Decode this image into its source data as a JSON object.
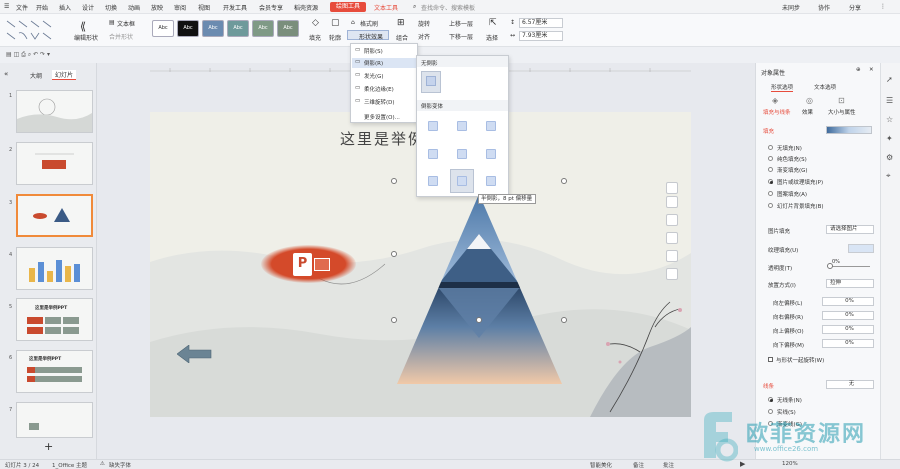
{
  "menu": {
    "items": [
      "文件",
      "开始",
      "插入",
      "设计",
      "切换",
      "动画",
      "放映",
      "审阅",
      "视图",
      "开发工具",
      "会员专享",
      "稻壳资源"
    ],
    "active_tab": "绘图工具",
    "text_tool": "文本工具",
    "search": "查找命令、搜索模板",
    "sync": "未同步",
    "collab": "协作",
    "share": "分享"
  },
  "ribbon": {
    "edit_shape": "编辑形状",
    "textbox": "文本框",
    "merge_shape": "合并形状",
    "style_labels": [
      "Abc",
      "Abc",
      "Abc",
      "Abc",
      "Abc",
      "Abc"
    ],
    "style_colors": [
      "#ffffff",
      "#111111",
      "#6b8bb0",
      "#6e9a9b",
      "#7f9a86",
      "#7a8e7c"
    ],
    "fill": "填充",
    "outline": "轮廓",
    "format_brush": "格式刷",
    "shape_effect": "形状效果",
    "group": "组合",
    "rotate": "旋转",
    "align": "对齐",
    "move_up": "上移一层",
    "move_down": "下移一层",
    "select": "选择",
    "height": "6.57厘米",
    "width": "7.93厘米"
  },
  "effect_menu": {
    "items": [
      "阴影(S)",
      "倒影(R)",
      "发光(G)",
      "柔化边缘(E)",
      "三维旋转(D)",
      "更多设置(O)..."
    ]
  },
  "reflection_menu": {
    "none_header": "无倒影",
    "variants_header": "倒影变体",
    "tooltip": "半倒影，8 pt 偏移量"
  },
  "left_panel": {
    "tab_outline": "大纲",
    "tab_slides": "幻灯片",
    "slide_numbers": [
      "1",
      "2",
      "3",
      "4",
      "5",
      "6",
      "7"
    ],
    "thumb_titles": [
      "",
      "",
      "",
      "",
      "这里是举例PPT",
      "这里是举例PPT",
      ""
    ],
    "add": "+"
  },
  "slide": {
    "title": "这里是举例",
    "bar_colors": [
      "#e9b64a",
      "#5b8fd6",
      "#e9b64a",
      "#5b8fd6",
      "#e9b64a",
      "#5b8fd6"
    ]
  },
  "right_panel": {
    "title": "对象属性",
    "tab_shape": "形状选项",
    "tab_text": "文本选项",
    "subtab_fill": "填充与线条",
    "subtab_effect": "效果",
    "subtab_size": "大小与属性",
    "fill_header": "填充",
    "fill_options": [
      "无填充(N)",
      "纯色填充(S)",
      "渐变填充(G)",
      "图片或纹理填充(P)",
      "图案填充(A)",
      "幻灯片背景填充(B)"
    ],
    "picture_fill_label": "图片填充",
    "picture_fill_value": "请选择图片",
    "texture_label": "纹理填充(U)",
    "transparency_label": "透明度(T)",
    "transparency_value": "0%",
    "mode_label": "放置方式(I)",
    "mode_value": "拉伸",
    "offsets": [
      {
        "label": "向左偏移(L)",
        "value": "0%"
      },
      {
        "label": "向右偏移(R)",
        "value": "0%"
      },
      {
        "label": "向上偏移(O)",
        "value": "0%"
      },
      {
        "label": "向下偏移(M)",
        "value": "0%"
      }
    ],
    "rotate_with_shape": "与形状一起旋转(W)",
    "line_header": "线条",
    "line_value": "无",
    "line_options": [
      "无线条(N)",
      "实线(S)",
      "渐变线(G)"
    ]
  },
  "status": {
    "slide": "幻灯片 3 / 24",
    "theme": "1_Office 主题",
    "font_missing": "缺失字体",
    "smart": "智能美化",
    "notes": "备注",
    "comments": "批注",
    "zoom": "120%"
  },
  "watermark": {
    "main": "欧菲资源网",
    "url": "www.office26.com"
  }
}
